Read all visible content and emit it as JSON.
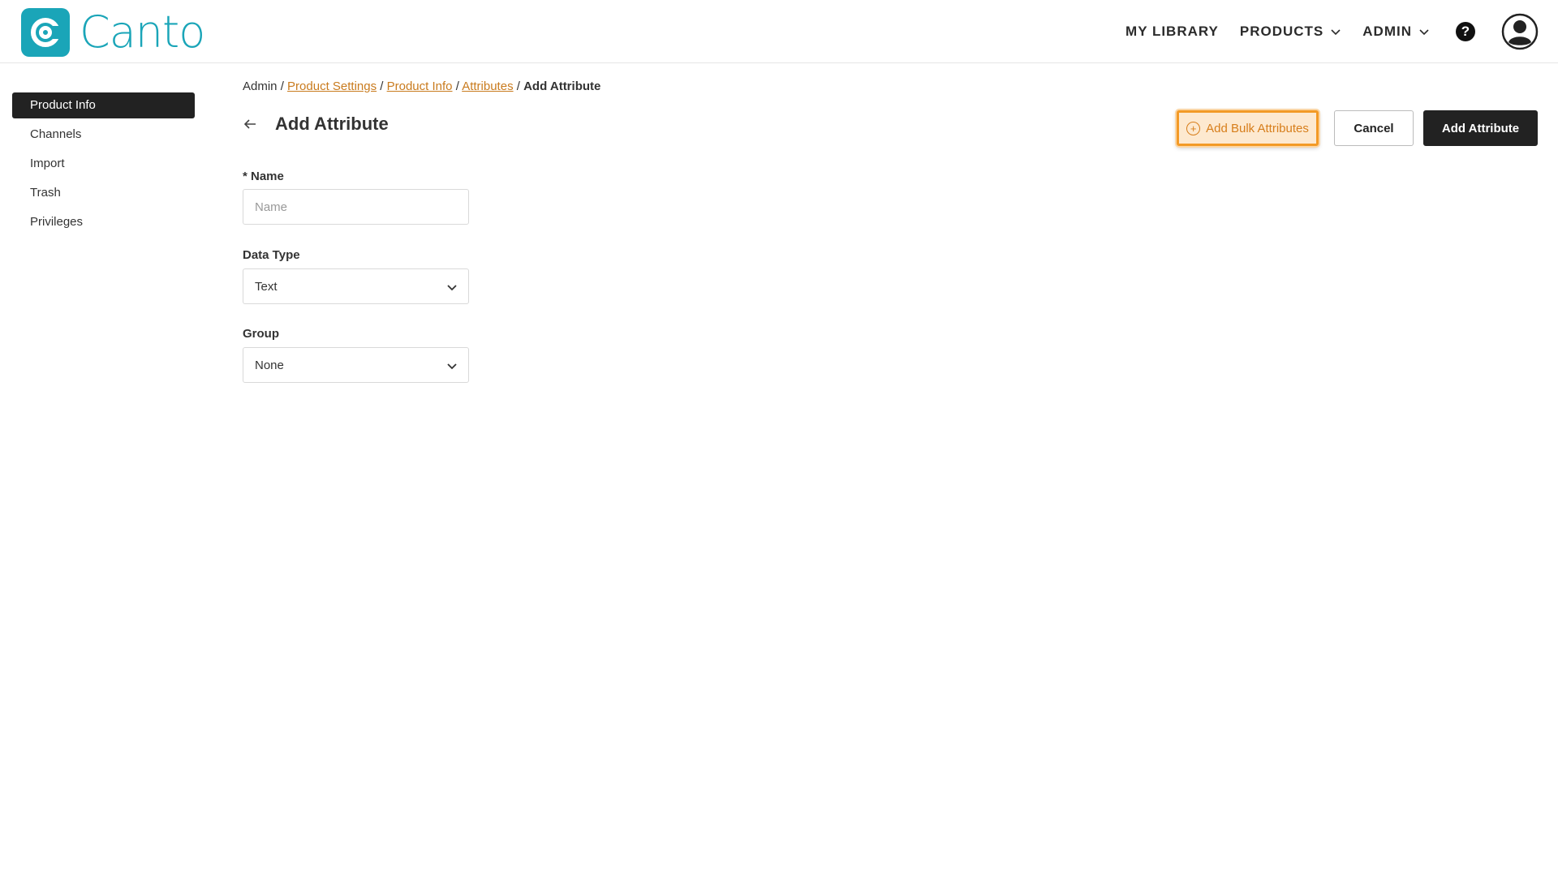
{
  "brand": {
    "name": "Canto",
    "color": "#1aa5b8"
  },
  "nav": {
    "my_library": "MY LIBRARY",
    "products": "PRODUCTS",
    "admin": "ADMIN",
    "help": "?"
  },
  "sidebar": {
    "items": [
      {
        "label": "Product Info",
        "active": true
      },
      {
        "label": "Channels"
      },
      {
        "label": "Import"
      },
      {
        "label": "Trash"
      },
      {
        "label": "Privileges"
      }
    ]
  },
  "breadcrumb": {
    "root": "Admin",
    "sep": "/",
    "links": [
      "Product Settings",
      "Product Info",
      "Attributes"
    ],
    "current": "Add Attribute"
  },
  "page": {
    "title": "Add Attribute"
  },
  "actions": {
    "bulk_label": "Add Bulk Attributes",
    "cancel_label": "Cancel",
    "add_label": "Add Attribute",
    "highlight_color": "#f39a26"
  },
  "form": {
    "name": {
      "label": "* Name",
      "placeholder": "Name",
      "value": ""
    },
    "data_type": {
      "label": "Data Type",
      "value": "Text"
    },
    "group": {
      "label": "Group",
      "value": "None"
    }
  }
}
